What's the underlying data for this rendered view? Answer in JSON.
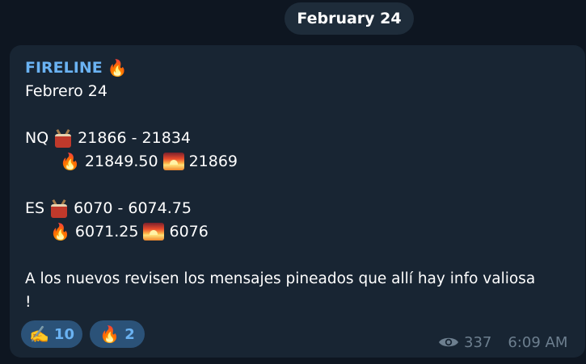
{
  "date_pill": "February 24",
  "message": {
    "sender": "FIRELINE",
    "sender_emoji": "🔥",
    "lines": {
      "date": "Febrero 24",
      "nq_label": "NQ",
      "nq_range": "21866 - 21834",
      "nq_fire": "21849.50",
      "nq_target": "21869",
      "es_label": "ES",
      "es_range": "6070 - 6074.75",
      "es_fire": "6071.25",
      "es_target": "6076",
      "note_line1": "A los nuevos revisen los mensajes pineados que allí hay info valiosa",
      "note_line2": "!"
    },
    "icons": {
      "drum": "drum-icon",
      "fire": "fire-icon",
      "sunrise": "sunrise-icon"
    }
  },
  "reactions": [
    {
      "emoji": "✍️",
      "count": "10"
    },
    {
      "emoji": "🔥",
      "count": "2"
    }
  ],
  "meta": {
    "views": "337",
    "time": "6:09 AM"
  },
  "colors": {
    "background": "#0e1621",
    "bubble": "#182533",
    "sender": "#6ab2f2",
    "reaction_bg": "#2b5278",
    "meta": "#6d7f8f"
  }
}
